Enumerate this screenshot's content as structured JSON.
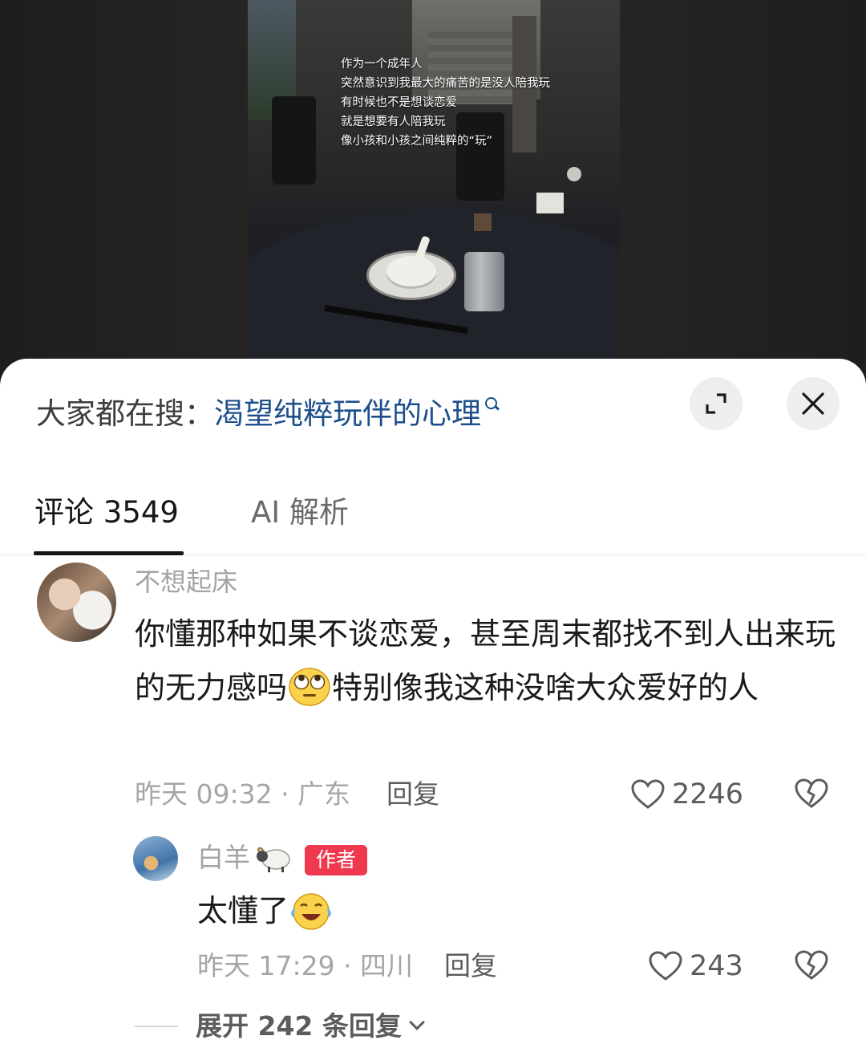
{
  "video": {
    "overlay_lines": [
      "作为一个成年人",
      "突然意识到我最大的痛苦的是没人陪我玩",
      "有时候也不是想谈恋爱",
      "就是想要有人陪我玩",
      "像小孩和小孩之间纯粹的“玩”"
    ]
  },
  "search": {
    "prefix": "大家都在搜：",
    "term": "渴望纯粹玩伴的心理",
    "icon": "search-icon"
  },
  "header_buttons": {
    "expand_icon": "expand-icon",
    "close_icon": "close-icon"
  },
  "tabs": {
    "comments_label": "评论 3549",
    "ai_label": "AI 解析"
  },
  "comment": {
    "username": "不想起床",
    "text_part1": "你懂那种如果不谈恋爱，甚至周末都找不到人出来玩的无力感吗",
    "text_part2": "特别像我这种没啥大众爱好的人",
    "emoji": "flushed-eye-roll-emoji",
    "time_location": "昨天 09:32 · 广东",
    "reply_label": "回复",
    "likes": "2246"
  },
  "reply": {
    "username": "白羊",
    "user_emoji": "sheep-emoji",
    "badge": "作者",
    "text": "太懂了",
    "emoji": "laughing-crying-emoji",
    "time_location": "昨天 17:29 · 四川",
    "reply_label": "回复",
    "likes": "243"
  },
  "expand": {
    "label": "展开 242 条回复"
  },
  "colors": {
    "link_blue": "#1d4f8c",
    "badge_red": "#f0394e",
    "meta_gray": "#a6a6a6"
  }
}
